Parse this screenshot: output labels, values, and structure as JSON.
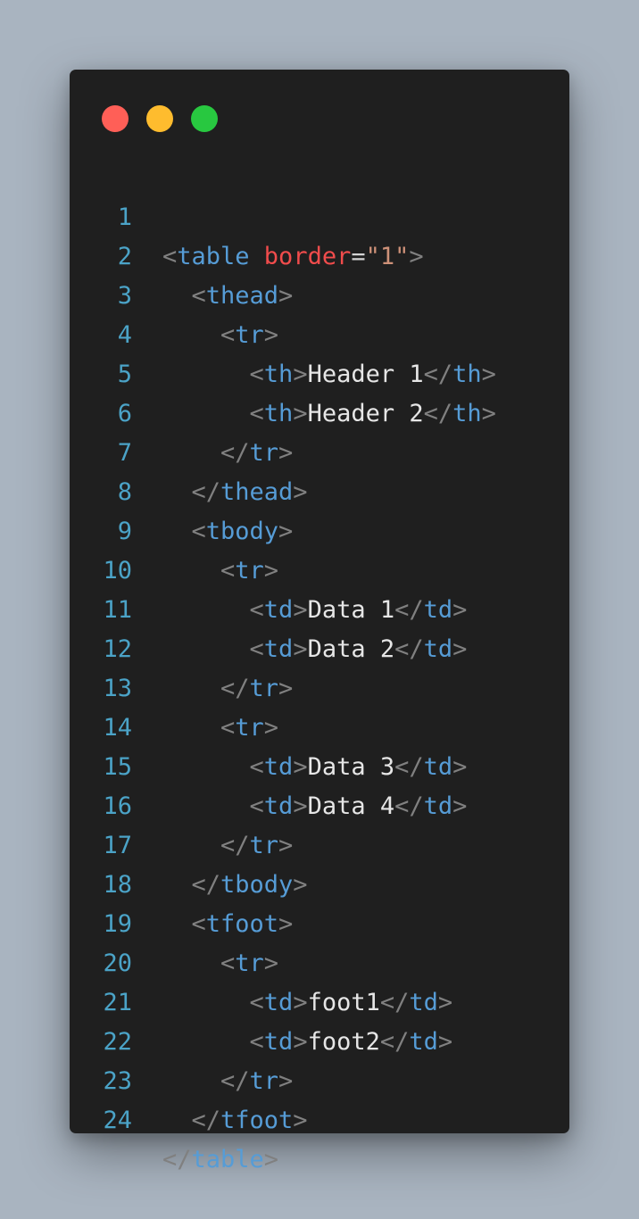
{
  "window": {
    "dots": [
      {
        "name": "close",
        "color": "#ff5f57"
      },
      {
        "name": "minimize",
        "color": "#febc2e"
      },
      {
        "name": "maximize",
        "color": "#28c840"
      }
    ]
  },
  "colors": {
    "background": "#a9b4c0",
    "editor": "#1f1f1f",
    "line_number": "#4ba3c7",
    "punctuation": "#808080",
    "tag": "#569cd6",
    "attribute": "#f14c4c",
    "string": "#ce9178",
    "text": "#e6e6e6"
  },
  "code": {
    "lines": [
      {
        "num": "1",
        "open": "<",
        "tag": "table",
        "attr": " border",
        "eq": "=",
        "val": "\"1\"",
        "close": ">"
      },
      {
        "num": "2",
        "open": "<",
        "tag": "thead",
        "close": ">"
      },
      {
        "num": "3",
        "open": "<",
        "tag": "tr",
        "close": ">"
      },
      {
        "num": "4",
        "open": "<",
        "tag": "th",
        "close": ">",
        "text": "Header 1",
        "end_open": "</",
        "end_tag": "th",
        "end_close": ">"
      },
      {
        "num": "5",
        "open": "<",
        "tag": "th",
        "close": ">",
        "text": "Header 2",
        "end_open": "</",
        "end_tag": "th",
        "end_close": ">"
      },
      {
        "num": "6",
        "open": "</",
        "tag": "tr",
        "close": ">"
      },
      {
        "num": "7",
        "open": "</",
        "tag": "thead",
        "close": ">"
      },
      {
        "num": "8",
        "open": "<",
        "tag": "tbody",
        "close": ">"
      },
      {
        "num": "9",
        "open": "<",
        "tag": "tr",
        "close": ">"
      },
      {
        "num": "10",
        "open": "<",
        "tag": "td",
        "close": ">",
        "text": "Data 1",
        "end_open": "</",
        "end_tag": "td",
        "end_close": ">"
      },
      {
        "num": "11",
        "open": "<",
        "tag": "td",
        "close": ">",
        "text": "Data 2",
        "end_open": "</",
        "end_tag": "td",
        "end_close": ">"
      },
      {
        "num": "12",
        "open": "</",
        "tag": "tr",
        "close": ">"
      },
      {
        "num": "13",
        "open": "<",
        "tag": "tr",
        "close": ">"
      },
      {
        "num": "14",
        "open": "<",
        "tag": "td",
        "close": ">",
        "text": "Data 3",
        "end_open": "</",
        "end_tag": "td",
        "end_close": ">"
      },
      {
        "num": "15",
        "open": "<",
        "tag": "td",
        "close": ">",
        "text": "Data 4",
        "end_open": "</",
        "end_tag": "td",
        "end_close": ">"
      },
      {
        "num": "16",
        "open": "</",
        "tag": "tr",
        "close": ">"
      },
      {
        "num": "17",
        "open": "</",
        "tag": "tbody",
        "close": ">"
      },
      {
        "num": "18",
        "open": "<",
        "tag": "tfoot",
        "close": ">"
      },
      {
        "num": "19",
        "open": "<",
        "tag": "tr",
        "close": ">"
      },
      {
        "num": "20",
        "open": "<",
        "tag": "td",
        "close": ">",
        "text": "foot1",
        "end_open": "</",
        "end_tag": "td",
        "end_close": ">"
      },
      {
        "num": "21",
        "open": "<",
        "tag": "td",
        "close": ">",
        "text": "foot2",
        "end_open": "</",
        "end_tag": "td",
        "end_close": ">"
      },
      {
        "num": "22",
        "open": "</",
        "tag": "tr",
        "close": ">"
      },
      {
        "num": "23",
        "open": "</",
        "tag": "tfoot",
        "close": ">"
      },
      {
        "num": "24",
        "open": "</",
        "tag": "table",
        "close": ">"
      }
    ]
  }
}
